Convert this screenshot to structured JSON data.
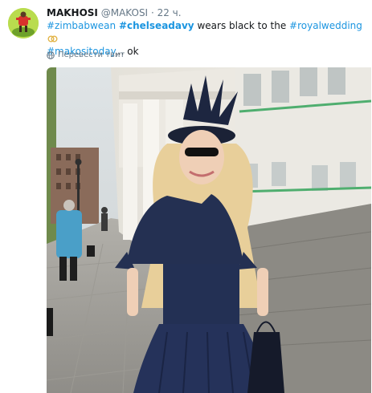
{
  "author": {
    "name": "MAKHOSI",
    "handle": "@MAKOSI",
    "separator": "·",
    "time": "22 ч."
  },
  "tweet": {
    "line1": {
      "tag1": "#zimbabwean",
      "tag2": "#chelseadavy",
      "text": " wears black to the ",
      "tag3": "#royalwedding"
    },
    "line2": {
      "tag": "#makositoday",
      "text": "... ok"
    }
  },
  "translate_label": "Перевести твит",
  "icons": {
    "avatar": "avatar-image",
    "ring": "ring-emoji-icon",
    "globe": "globe-icon"
  },
  "colors": {
    "link": "#1b95e0",
    "muted": "#657786"
  }
}
